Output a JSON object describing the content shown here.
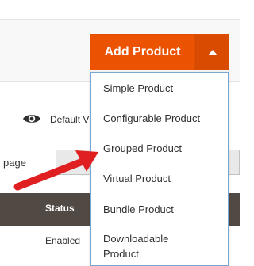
{
  "toolbar": {
    "add_product_label": "Add Product"
  },
  "grid": {
    "default_view": "Default V",
    "per_page_label": "page",
    "columns": {
      "status": "Status"
    },
    "rows": [
      {
        "status": "Enabled"
      }
    ]
  },
  "dropdown": {
    "items": [
      {
        "label": "Simple Product"
      },
      {
        "label": "Configurable Product"
      },
      {
        "label": "Grouped Product"
      },
      {
        "label": "Virtual Product"
      },
      {
        "label": "Bundle Product"
      },
      {
        "label": "Downloadable Product"
      }
    ]
  },
  "icons": {
    "eye": "eye-icon",
    "caret": "caret-up-icon",
    "annotation": "red-arrow-annotation"
  },
  "colors": {
    "accent": "#eb5202",
    "table_header": "#514943",
    "dropdown_border": "#7aa7d1",
    "annotation_arrow": "#e02020"
  }
}
